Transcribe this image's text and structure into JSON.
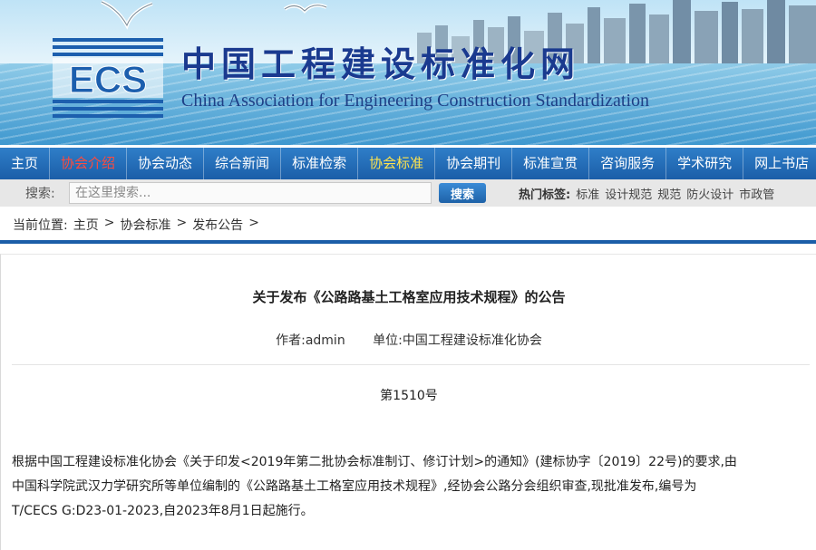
{
  "site": {
    "title_cn": "中国工程建设标准化网",
    "title_en": "China Association for Engineering Construction Standardization",
    "logo_text": "ECS"
  },
  "nav": {
    "items": [
      {
        "label": "主页"
      },
      {
        "label": "协会介绍",
        "color": "#ff4a3d"
      },
      {
        "label": "协会动态"
      },
      {
        "label": "综合新闻"
      },
      {
        "label": "标准检索"
      },
      {
        "label": "协会标准",
        "color": "#ffe44d"
      },
      {
        "label": "协会期刊"
      },
      {
        "label": "标准宣贯"
      },
      {
        "label": "咨询服务"
      },
      {
        "label": "学术研究"
      },
      {
        "label": "网上书店"
      }
    ]
  },
  "search": {
    "label": "搜索:",
    "placeholder": "在这里搜索...",
    "button": "搜索",
    "hot_label": "热门标签:",
    "hot_tags": [
      "标准",
      "设计规范",
      "规范",
      "防火设计",
      "市政管"
    ]
  },
  "breadcrumb": {
    "prefix": "当前位置:",
    "items": [
      "主页",
      "协会标准",
      "发布公告"
    ],
    "separator": ">"
  },
  "article": {
    "title": "关于发布《公路路基土工格室应用技术规程》的公告",
    "author": "作者:admin",
    "unit": "单位:中国工程建设标准化协会",
    "number": "第1510号",
    "body_lines": [
      "根据中国工程建设标准化协会《关于印发<2019年第二批协会标准制订、修订计划>的通知》(建标协字〔2019〕22号)的要求,由",
      "中国科学院武汉力学研究所等单位编制的《公路路基土工格室应用技术规程》,经协会公路分会组织审查,现批准发布,编号为",
      "T/CECS G:D23-01-2023,自2023年8月1日起施行。"
    ]
  },
  "colors": {
    "nav_bg": "#1b5ea8",
    "accent_red": "#ff4a3d",
    "accent_yellow": "#ffe44d",
    "title_blue": "#1a3a8f"
  }
}
